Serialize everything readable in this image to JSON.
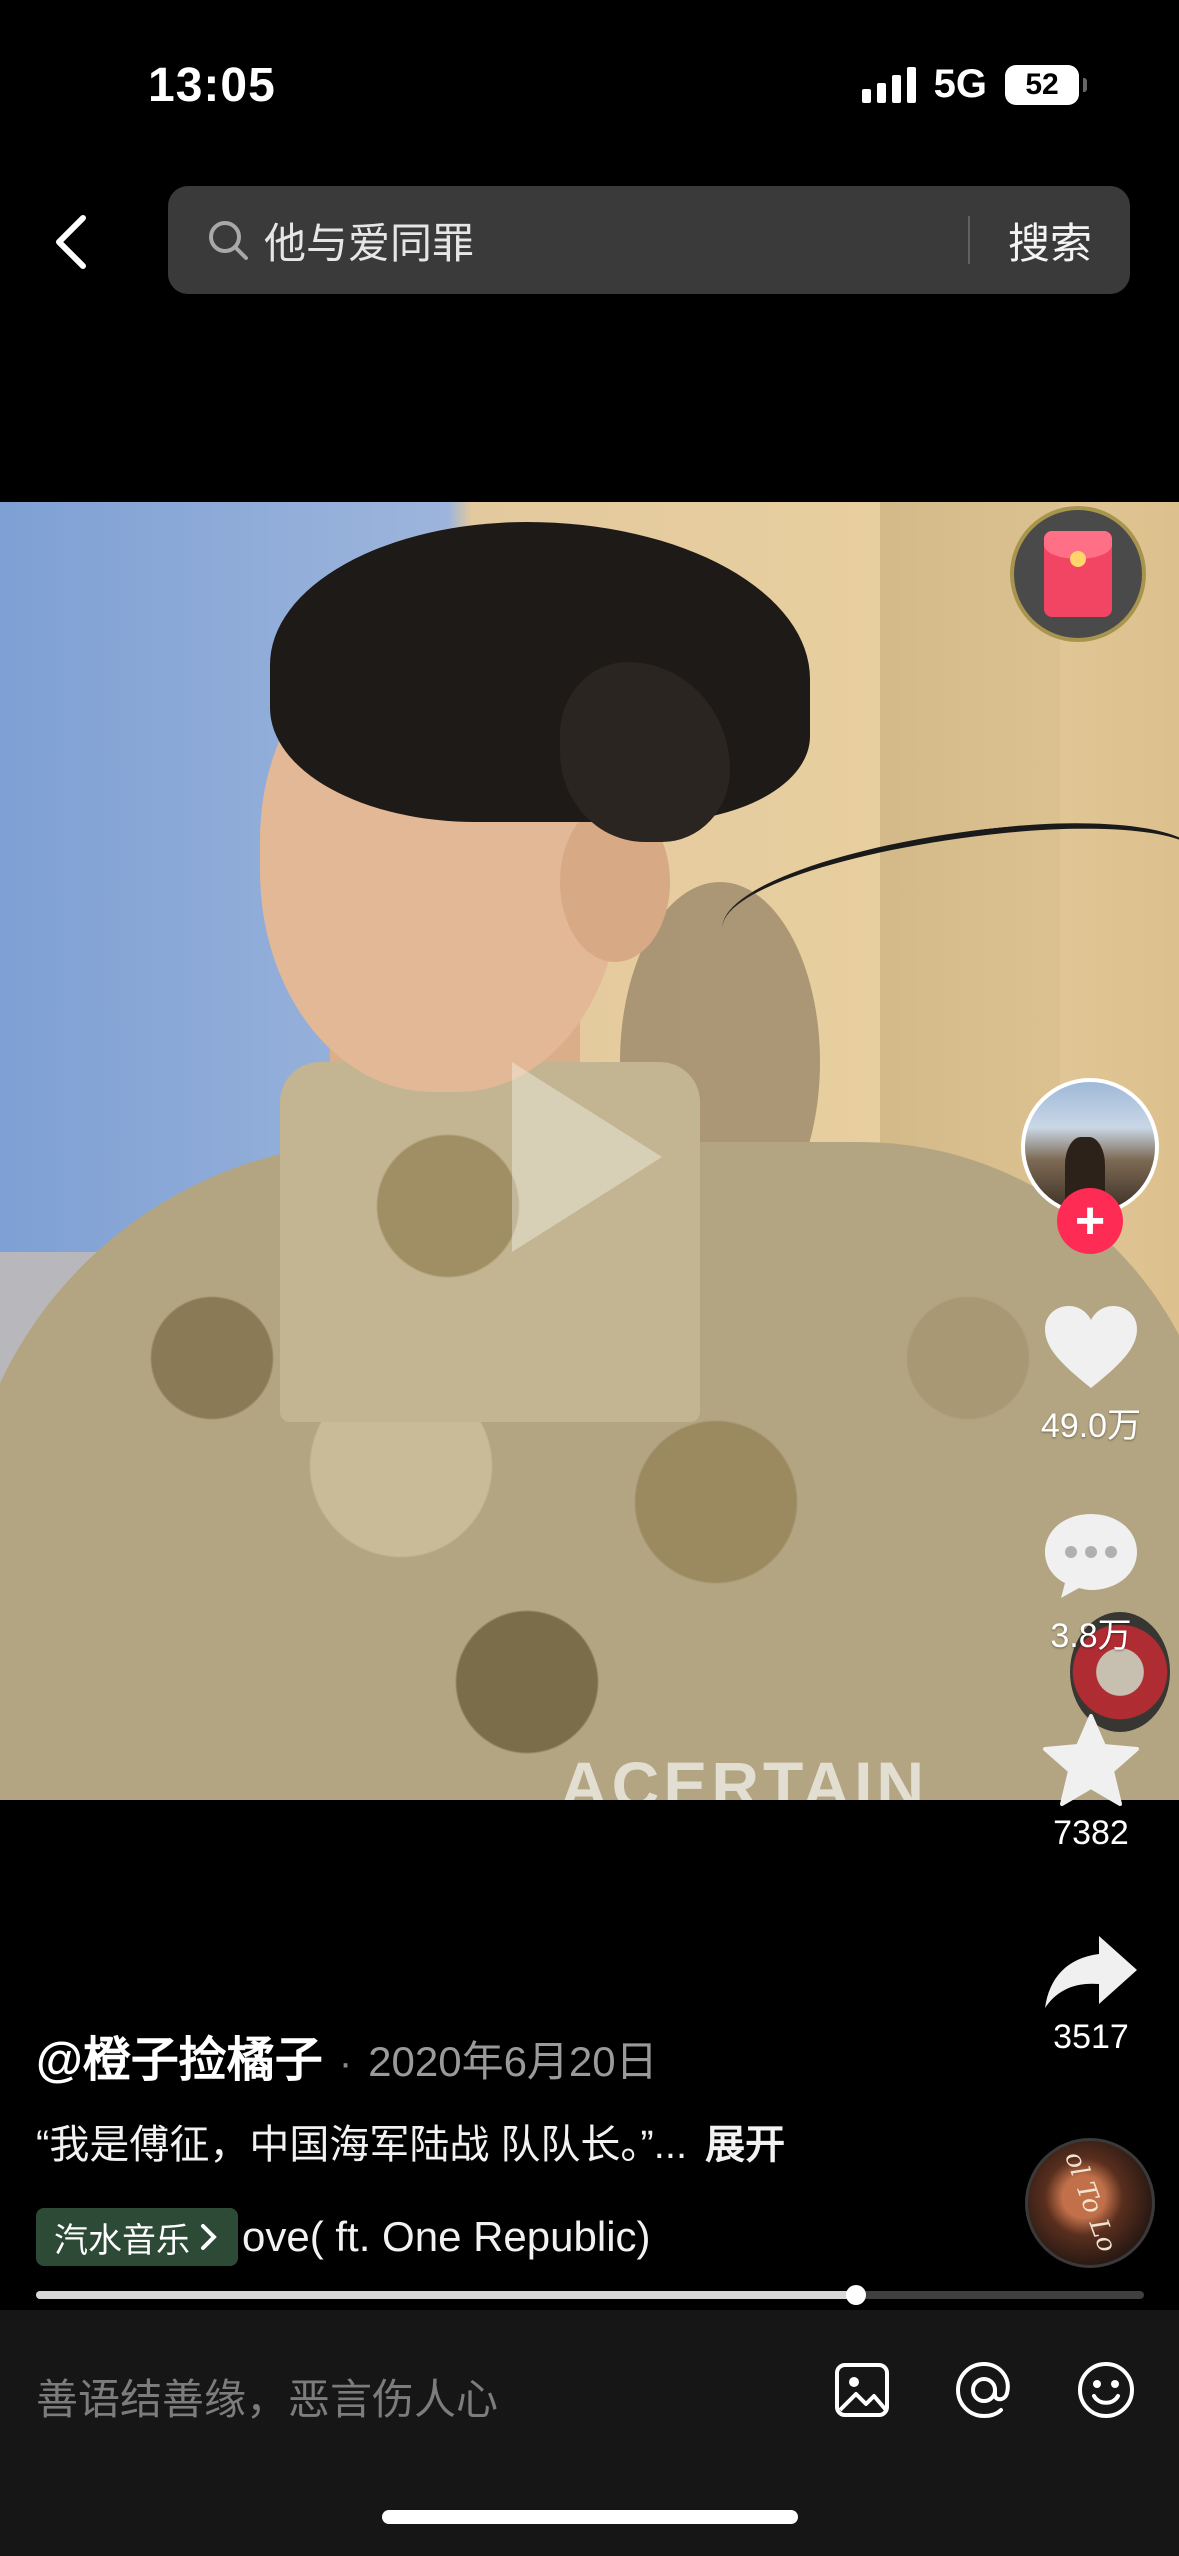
{
  "status_bar": {
    "time": "13:05",
    "network": "5G",
    "battery": "52"
  },
  "search": {
    "query": "他与爱同罪",
    "button_label": "搜索"
  },
  "video": {
    "overlay_text": "ACERTAIN"
  },
  "rail": {
    "like_count": "49.0万",
    "comment_count": "3.8万",
    "favorite_count": "7382",
    "share_count": "3517",
    "follow_label": "+"
  },
  "post": {
    "author": "@橙子捡橘子",
    "separator": "·",
    "date": "2020年6月20日",
    "description": "“我是傅征，中国海军陆战 队队长。”...",
    "expand_label": "展开",
    "music_tag": "汽水音乐",
    "song": "ove( ft. One Republic)",
    "disc_text": "ol To Lo",
    "progress_fraction": 0.74
  },
  "comment_bar": {
    "placeholder": "善语结善缘，恶言伤人心"
  },
  "colors": {
    "accent_red": "#fe2c55",
    "background": "#000000",
    "bar_bg": "#161616",
    "music_tag_bg": "#2c4a36"
  },
  "icons": [
    "back-arrow-icon",
    "search-icon",
    "red-packet-icon",
    "heart-icon",
    "comment-bubble-icon",
    "star-icon",
    "share-arrow-icon",
    "image-icon",
    "at-icon",
    "emoji-icon"
  ]
}
